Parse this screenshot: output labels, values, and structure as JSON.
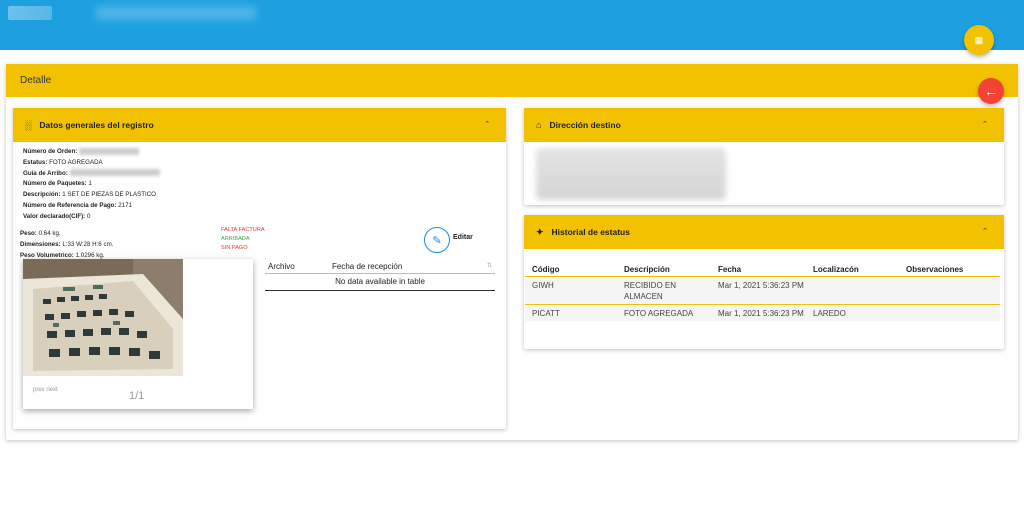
{
  "header": {
    "grid_icon": "grid-icon",
    "back_icon": "arrow-left-icon"
  },
  "panel": {
    "title": "Detalle"
  },
  "general": {
    "title": "Datos generales del registro",
    "icon": "barcode-icon",
    "fields": [
      {
        "label": "Número de Orden:",
        "value": ""
      },
      {
        "label": "Estatus:",
        "value": "FOTO AGREGADA"
      },
      {
        "label": "Guía de Arribo:",
        "value": ""
      },
      {
        "label": "Número de Paquetes:",
        "value": "1"
      },
      {
        "label": "Descripción:",
        "value": "1 SET DE PIEZAS DE PLASTICO"
      },
      {
        "label": "Número de Referencia de Pago:",
        "value": "2171"
      },
      {
        "label": "Valor declarado(CIF):",
        "value": "0"
      },
      {
        "label": "Peso:",
        "value": "0.64 kg."
      },
      {
        "label": "Dimensiones:",
        "value": "L:33 W:28 H:6 cm."
      },
      {
        "label": "Peso Volumetrico:",
        "value": "1.0296 kg."
      }
    ],
    "status_tags": [
      {
        "text": "FALTA FACTURA",
        "color": "#e53935"
      },
      {
        "text": "ARRIBADA",
        "color": "#43a047"
      },
      {
        "text": "SIN PAGO",
        "color": "#e53935"
      }
    ],
    "edit_label": "Editar",
    "gallery": {
      "prev": "prev",
      "next": "next",
      "counter": "1/1"
    },
    "files_table": {
      "columns": [
        "Archivo",
        "Fecha de recepción"
      ],
      "empty": "No data available in table"
    }
  },
  "address": {
    "title": "Dirección destino",
    "icon": "home-icon"
  },
  "history": {
    "title": "Historial de estatus",
    "icon": "satellite-icon",
    "columns": [
      "Código",
      "Descripción",
      "Fecha",
      "Localizacón",
      "Observaciones"
    ],
    "rows": [
      [
        "GIWH",
        "RECIBIDO EN ALMACEN",
        "Mar 1, 2021 5:36:23 PM",
        "",
        ""
      ],
      [
        "PICATT",
        "FOTO AGREGADA",
        "Mar 1, 2021 5:36:23 PM",
        "LAREDO",
        ""
      ]
    ]
  },
  "colors": {
    "accent": "#f2c200",
    "topbar": "#1ea0e0",
    "danger": "#f44336",
    "link": "#1e88e5"
  }
}
